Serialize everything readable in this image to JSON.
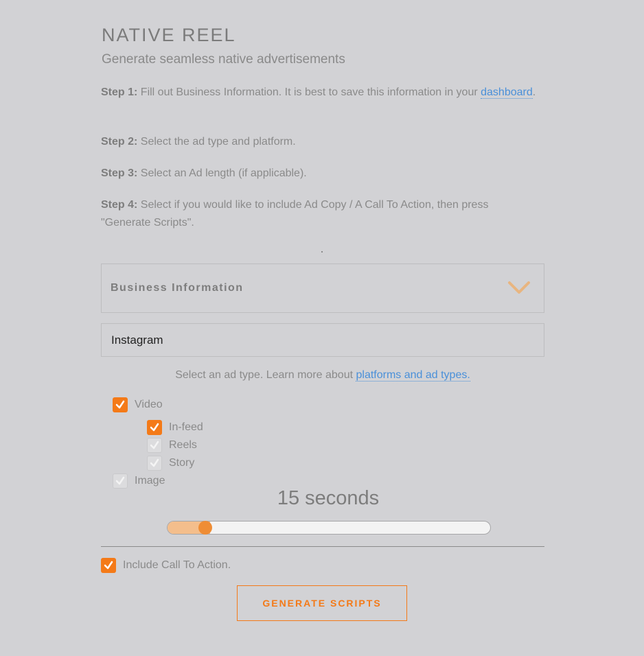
{
  "header": {
    "title": "NATIVE REEL",
    "subtitle": "Generate seamless native advertisements"
  },
  "steps": [
    {
      "label": "Step 1:",
      "text": " Fill out Business Information. It is best to save this information in your ",
      "link": "dashboard",
      "tail": "."
    },
    {
      "label": "Step 2:",
      "text": " Select the ad type and platform."
    },
    {
      "label": "Step 3:",
      "text": " Select an Ad length (if applicable)."
    },
    {
      "label": "Step 4:",
      "text": " Select if you would like to include Ad Copy / A Call To Action, then press \"Generate Scripts\"."
    }
  ],
  "business": {
    "label": "Business Information",
    "icon": "chevron-down-icon",
    "icon_color": "#e8b580"
  },
  "platform": {
    "selected": "Instagram"
  },
  "adtype": {
    "hint": "Select an ad type. Learn more about ",
    "link": "platforms and ad types.",
    "options": [
      {
        "label": "Video",
        "checked": true
      },
      {
        "label": "In-feed",
        "checked": true
      },
      {
        "label": "Reels",
        "checked": false
      },
      {
        "label": "Story",
        "checked": false
      },
      {
        "label": "Image",
        "checked": false
      }
    ]
  },
  "length": {
    "label": "15 seconds",
    "value_fraction": 0.12
  },
  "cta": {
    "label": "Include Call To Action.",
    "checked": true
  },
  "actions": {
    "generate_label": "GENERATE SCRIPTS"
  },
  "colors": {
    "accent": "#f47a18",
    "link": "#4a90d9",
    "background": "#d2d2d5"
  }
}
